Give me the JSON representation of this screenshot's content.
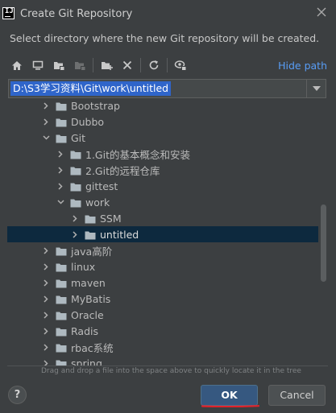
{
  "window": {
    "title": "Create Git Repository",
    "description": "Select directory where the new Git repository will be created."
  },
  "toolbar": {
    "buttons": [
      {
        "icon": "home-icon"
      },
      {
        "icon": "desktop-icon"
      },
      {
        "icon": "project-folder-icon"
      },
      {
        "icon": "module-folder-icon"
      },
      {
        "icon": "new-folder-icon"
      },
      {
        "icon": "delete-icon"
      },
      {
        "icon": "refresh-icon"
      },
      {
        "icon": "show-hidden-icon"
      }
    ],
    "hide_path_label": "Hide path"
  },
  "path": {
    "value": "D:\\S3学习资料\\Git\\work\\untitled"
  },
  "tree": {
    "rows": [
      {
        "label": "Bootstrap",
        "depth": 2,
        "expanded": false
      },
      {
        "label": "Dubbo",
        "depth": 2,
        "expanded": false
      },
      {
        "label": "Git",
        "depth": 2,
        "expanded": true
      },
      {
        "label": "1.Git的基本概念和安装",
        "depth": 3,
        "expanded": false
      },
      {
        "label": "2.Git的远程仓库",
        "depth": 3,
        "expanded": false
      },
      {
        "label": "gittest",
        "depth": 3,
        "expanded": false
      },
      {
        "label": "work",
        "depth": 3,
        "expanded": true
      },
      {
        "label": "SSM",
        "depth": 4,
        "expanded": false
      },
      {
        "label": "untitled",
        "depth": 4,
        "expanded": false,
        "selected": true
      },
      {
        "label": "java高阶",
        "depth": 2,
        "expanded": false
      },
      {
        "label": "linux",
        "depth": 2,
        "expanded": false
      },
      {
        "label": "maven",
        "depth": 2,
        "expanded": false
      },
      {
        "label": "MyBatis",
        "depth": 2,
        "expanded": false
      },
      {
        "label": "Oracle",
        "depth": 2,
        "expanded": false
      },
      {
        "label": "Radis",
        "depth": 2,
        "expanded": false
      },
      {
        "label": "rbac系统",
        "depth": 2,
        "expanded": false
      },
      {
        "label": "spring",
        "depth": 2,
        "expanded": false
      }
    ]
  },
  "hint": "Drag and drop a file into the space above to quickly locate it in the tree",
  "footer": {
    "help_label": "?",
    "ok_label": "OK",
    "cancel_label": "Cancel"
  },
  "colors": {
    "background": "#3c3f41",
    "selection": "#0d293e",
    "link": "#589df6",
    "path_highlight": "#2f65ca",
    "ok_button": "#365880",
    "annotation_red": "#e0222b"
  }
}
